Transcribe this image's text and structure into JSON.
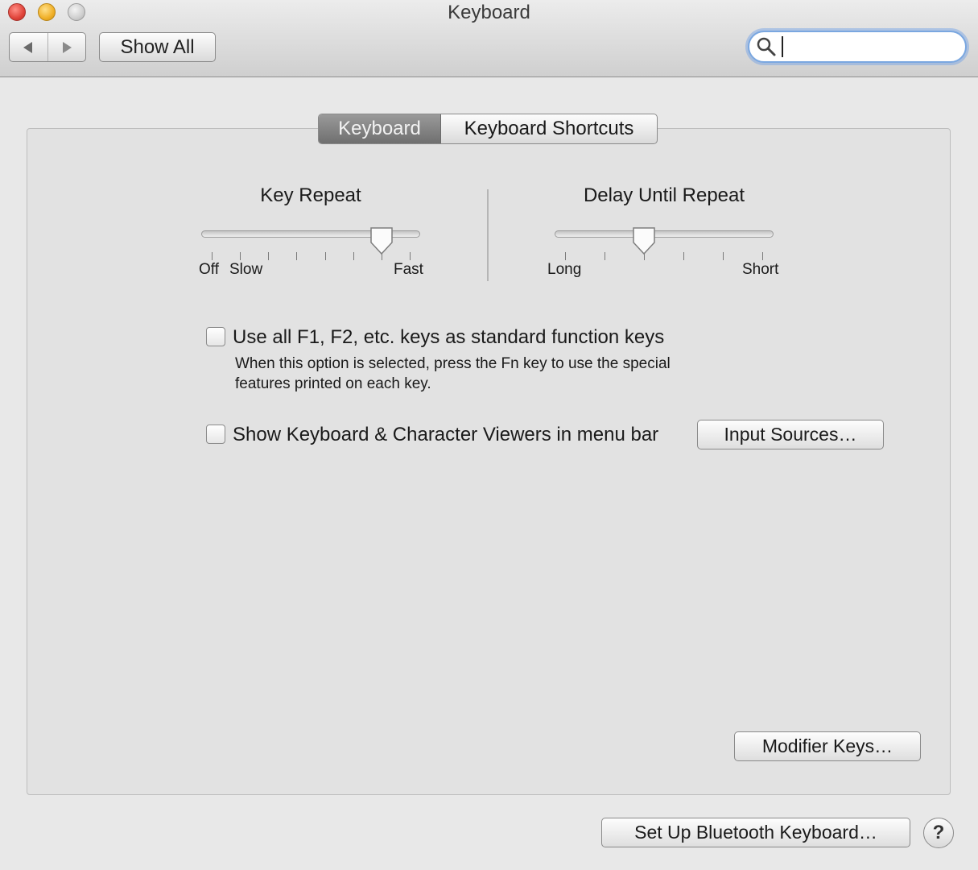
{
  "window": {
    "title": "Keyboard",
    "traffic_lights": [
      "close",
      "minimize",
      "zoom"
    ]
  },
  "toolbar": {
    "back_icon": "back-arrow-icon",
    "forward_icon": "forward-arrow-icon",
    "show_all_label": "Show All",
    "search_value": "",
    "search_icon": "search-icon"
  },
  "tabs": [
    {
      "label": "Keyboard",
      "active": true
    },
    {
      "label": "Keyboard Shortcuts",
      "active": false
    }
  ],
  "key_repeat": {
    "title": "Key Repeat",
    "labels": {
      "off": "Off",
      "slow": "Slow",
      "fast": "Fast"
    },
    "tick_count": 8,
    "value_fraction": 0.857
  },
  "delay_until_repeat": {
    "title": "Delay Until Repeat",
    "labels": {
      "long": "Long",
      "short": "Short"
    },
    "tick_count": 6,
    "value_fraction": 0.4
  },
  "options": {
    "function_keys": {
      "label": "Use all F1, F2, etc. keys as standard function keys",
      "checked": false,
      "help_line1": "When this option is selected, press the Fn key to use the special",
      "help_line2": "features printed on each key."
    },
    "show_viewers": {
      "label": "Show Keyboard & Character Viewers in menu bar",
      "checked": false
    }
  },
  "buttons": {
    "input_sources": "Input Sources…",
    "modifier_keys": "Modifier Keys…",
    "bluetooth_keyboard": "Set Up Bluetooth Keyboard…",
    "help": "?"
  }
}
